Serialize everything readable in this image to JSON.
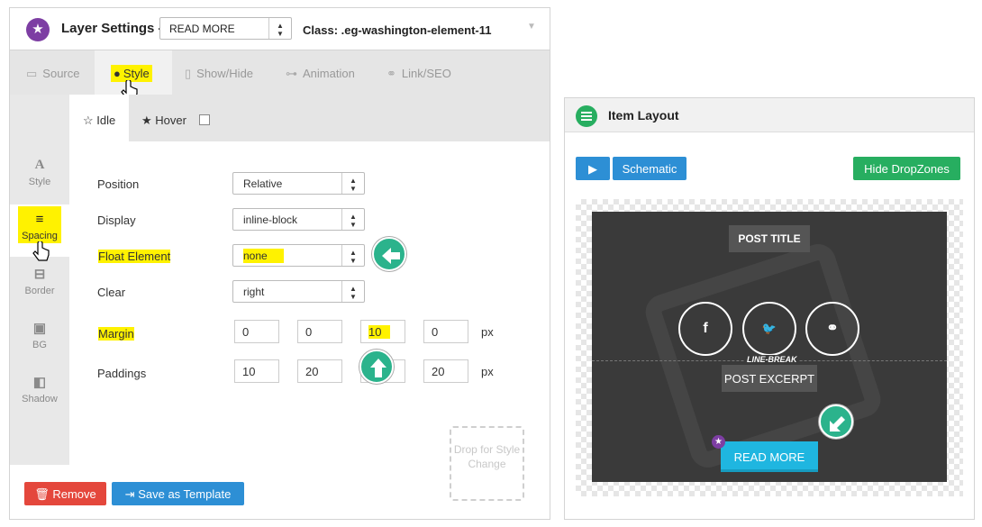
{
  "layer_settings": {
    "title": "Layer Settings -",
    "element_select": "READ MORE",
    "class_label": "Class: .eg-washington-element-11",
    "tabs": [
      {
        "label": "Source",
        "icon": "folder-icon"
      },
      {
        "label": "Style",
        "icon": "drop-icon"
      },
      {
        "label": "Show/Hide",
        "icon": "tablet-icon"
      },
      {
        "label": "Animation",
        "icon": "toggle-icon"
      },
      {
        "label": "Link/SEO",
        "icon": "link-icon"
      }
    ],
    "side_items": [
      {
        "label": "Style",
        "icon": "A"
      },
      {
        "label": "Spacing",
        "icon": "≡"
      },
      {
        "label": "Border",
        "icon": "⊟"
      },
      {
        "label": "BG",
        "icon": "▣"
      },
      {
        "label": "Shadow",
        "icon": "◧"
      }
    ],
    "subtabs": {
      "idle": "Idle",
      "hover": "Hover"
    },
    "fields": {
      "position": {
        "label": "Position",
        "value": "Relative"
      },
      "display": {
        "label": "Display",
        "value": "inline-block"
      },
      "float": {
        "label": "Float Element",
        "value": "none"
      },
      "clear": {
        "label": "Clear",
        "value": "right"
      },
      "margin": {
        "label": "Margin",
        "values": [
          "0",
          "0",
          "10",
          "0"
        ],
        "unit": "px"
      },
      "paddings": {
        "label": "Paddings",
        "values": [
          "10",
          "20",
          "",
          "20"
        ],
        "unit": "px"
      }
    },
    "dropzone_text": "Drop for Style Change",
    "remove_label": "Remove",
    "template_label": "Save as Template"
  },
  "item_layout": {
    "title": "Item Layout",
    "schematic_label": "Schematic",
    "hide_dropzones_label": "Hide DropZones",
    "preview": {
      "post_title": "POST TITLE",
      "social": [
        "f",
        "t",
        "link"
      ],
      "line_break": "LINE-BREAK",
      "post_excerpt": "POST EXCERPT",
      "read_more": "READ MORE"
    }
  },
  "colors": {
    "highlight": "#fff200",
    "accent_green": "#2bb38c",
    "brand_purple": "#7d3ea3",
    "button_blue": "#2d8fd5",
    "button_red": "#e4473c",
    "read_more_cyan": "#1fb6e0"
  }
}
